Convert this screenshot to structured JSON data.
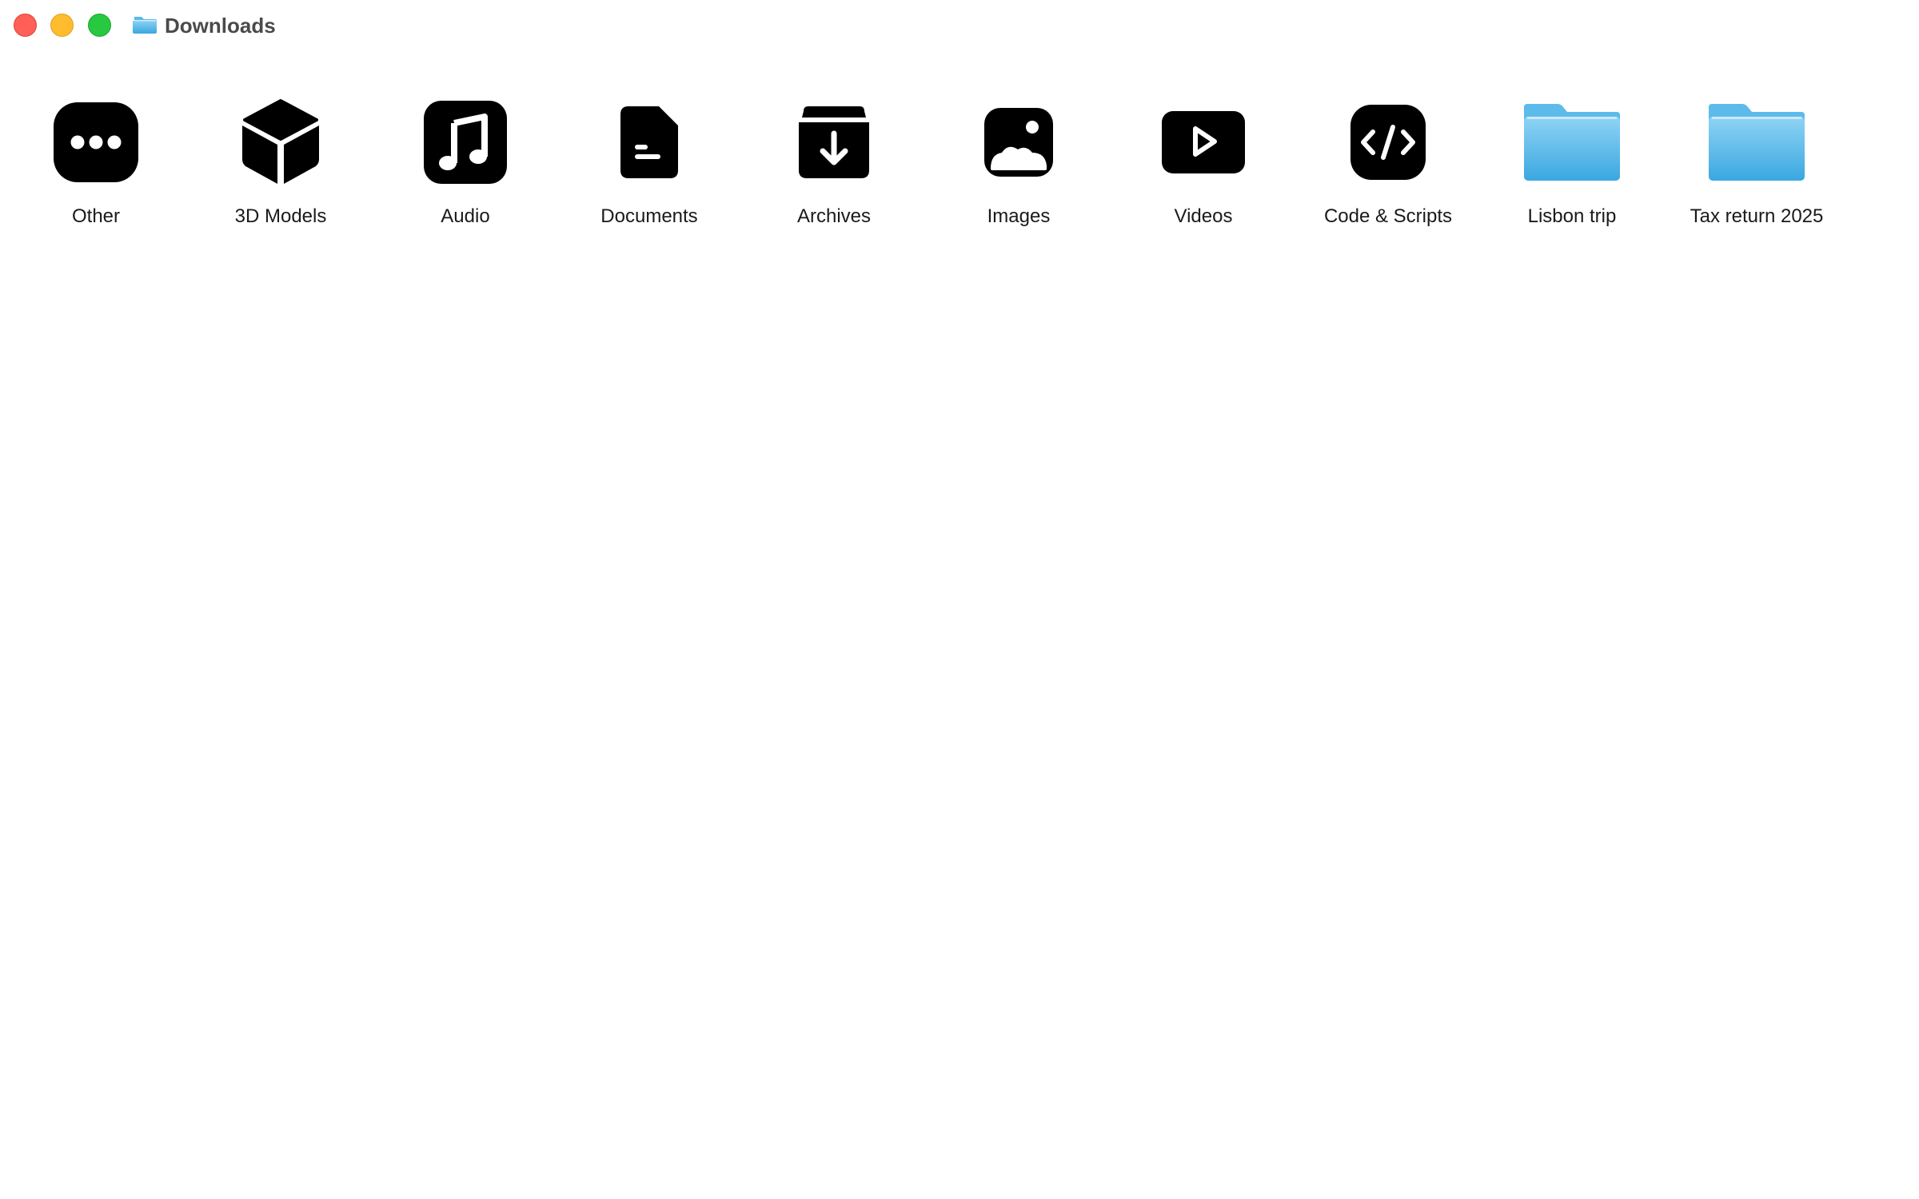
{
  "window": {
    "title": "Downloads",
    "title_icon": "folder-icon"
  },
  "items": [
    {
      "label": "Other",
      "icon": "ellipsis-icon"
    },
    {
      "label": "3D Models",
      "icon": "cube-icon"
    },
    {
      "label": "Audio",
      "icon": "music-note-icon"
    },
    {
      "label": "Documents",
      "icon": "document-icon"
    },
    {
      "label": "Archives",
      "icon": "archive-box-icon"
    },
    {
      "label": "Images",
      "icon": "image-icon"
    },
    {
      "label": "Videos",
      "icon": "play-icon"
    },
    {
      "label": "Code & Scripts",
      "icon": "code-icon"
    },
    {
      "label": "Lisbon trip",
      "icon": "folder-icon"
    },
    {
      "label": "Tax return 2025",
      "icon": "folder-icon"
    }
  ],
  "colors": {
    "folder_light": "#8fd3f5",
    "folder_dark": "#3aa7e0",
    "icon_black": "#000000"
  }
}
